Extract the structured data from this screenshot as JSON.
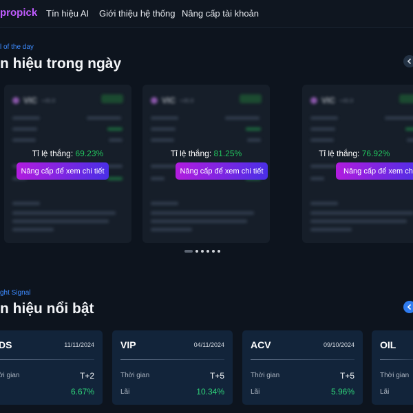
{
  "nav": {
    "logo": "propick",
    "items": [
      "Tín hiệu AI",
      "Giới thiệu hệ thống",
      "Nâng cấp tài khoản"
    ]
  },
  "section1": {
    "eyebrow": "l of the day",
    "title": "n hiệu trong ngày"
  },
  "signal_cards": [
    {
      "winrate_label": "Tỉ lệ thắng:",
      "winrate": "69.23%",
      "button": "Nâng cấp để xem chi tiết",
      "ticker": "VIC"
    },
    {
      "winrate_label": "Tỉ lệ thắng:",
      "winrate": "81.25%",
      "button": "Nâng cấp để xem chi tiết",
      "ticker": "VIC"
    },
    {
      "winrate_label": "Tỉ lệ thắng:",
      "winrate": "76.92%",
      "button": "Nâng cấp để xem chi tiết",
      "ticker": "VIC"
    }
  ],
  "pagination": {
    "count": 6,
    "active": 0
  },
  "section2": {
    "eyebrow": "ght Signal",
    "title": "n hiệu nổi bật"
  },
  "featured_cards": [
    {
      "ticker": "DS",
      "date": "11/11/2024",
      "time_label": "ời gian",
      "time": "T+2",
      "profit_label": "",
      "profit": "6.67%"
    },
    {
      "ticker": "VIP",
      "date": "04/11/2024",
      "time_label": "Thời gian",
      "time": "T+5",
      "profit_label": "Lãi",
      "profit": "10.34%"
    },
    {
      "ticker": "ACV",
      "date": "09/10/2024",
      "time_label": "Thời gian",
      "time": "T+5",
      "profit_label": "Lãi",
      "profit": "5.96%"
    },
    {
      "ticker": "OIL",
      "date": "",
      "time_label": "Thời gian",
      "time": "",
      "profit_label": "Lãi",
      "profit": ""
    }
  ],
  "colors": {
    "brand": "#c05cff",
    "accent": "#3d8bff",
    "positive": "#22c55e"
  }
}
